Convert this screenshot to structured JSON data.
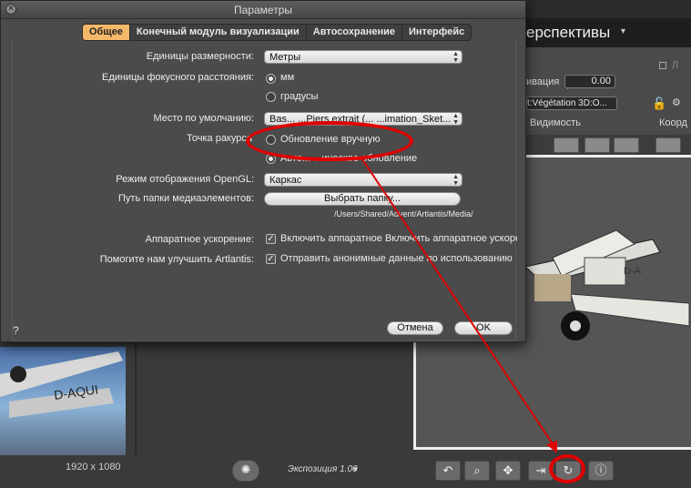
{
  "dialog": {
    "title": "Параметры",
    "tabs": [
      "Общее",
      "Конечный модуль визуализации",
      "Автосохранение",
      "Интерфейс"
    ],
    "active_tab": 0,
    "units_label": "Единицы размерности:",
    "units_value": "Метры",
    "focal_label": "Единицы фокусного расстояния:",
    "focal_opt1": "мм",
    "focal_opt2": "градусы",
    "default_place_label": "Место по умолчанию:",
    "default_place_value": "Bas... ...Piers extrait (... ...imation_Sket...",
    "viewpoint_label": "Точка ракурса",
    "viewpoint_opt1": "Обновление вручную",
    "viewpoint_opt2": "Авто... ...ическое обновление",
    "opengl_label": "Режим отображения OpenGL:",
    "opengl_value": "Каркас",
    "media_label": "Путь папки медиаэлементов:",
    "media_button": "Выбрать папку...",
    "media_path": "/Users/Shared/Advent/Artlantis/Media/",
    "hw_label": "Аппаратное ускорение:",
    "hw_check": "Включить аппаратное Включить аппаратное ускорен",
    "improve_label": "Помогите нам улучшить Artlantis:",
    "improve_check": "Отправить анонимные данные по использованию",
    "help": "?",
    "cancel": "Отмена",
    "ok": "OK",
    "close_glyph": "×"
  },
  "background": {
    "title": "ерспективы",
    "chevron": "▾",
    "activation_label": "ивация",
    "activation_value": "0.00",
    "curl_glyph": "(",
    "lock_label": "Л",
    "vegetation_value": "t:Végétation 3D:O...",
    "visibility_header": "Видимость",
    "coords_header": "Коорд",
    "resolution": "1920 x 1080",
    "exposure": "Экспозиция 1.00",
    "exposure_arrow": "▾"
  },
  "colors": {
    "annotation_red": "#e00000",
    "active_tab": "#f5b86a"
  },
  "icons": [
    "close-icon",
    "popup-arrows-icon",
    "sun-icon",
    "undo-icon",
    "zoom-icon",
    "move-icon",
    "import-icon",
    "refresh-icon",
    "info-icon"
  ]
}
